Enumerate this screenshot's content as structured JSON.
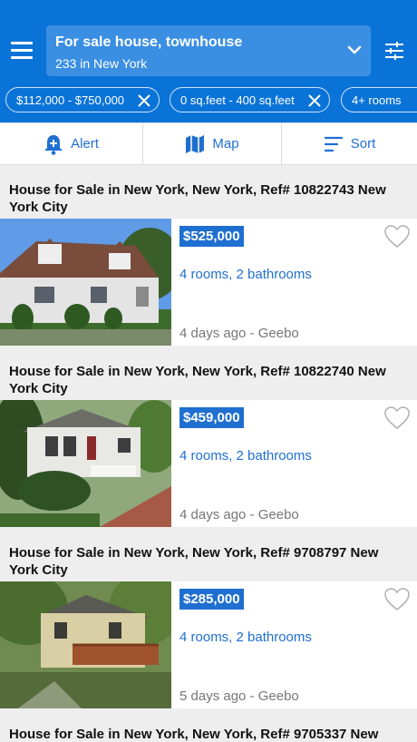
{
  "header": {
    "search_title": "For sale house, townhouse",
    "search_subtitle": "233 in New York",
    "background_color": "#0a73d8"
  },
  "filters": [
    {
      "label": "$112,000 - $750,000"
    },
    {
      "label": "0 sq.feet - 400 sq.feet"
    },
    {
      "label": "4+ rooms"
    }
  ],
  "toolbar": {
    "alert_label": "Alert",
    "map_label": "Map",
    "sort_label": "Sort"
  },
  "listings": [
    {
      "title": "House for Sale in New York, New York, Ref# 10822743 New York City",
      "price": "$525,000",
      "rooms": "4 rooms, 2 bathrooms",
      "age": "4 days ago - Geebo"
    },
    {
      "title": "House for Sale in New York, New York, Ref# 10822740 New York City",
      "price": "$459,000",
      "rooms": "4 rooms, 2 bathrooms",
      "age": "4 days ago - Geebo"
    },
    {
      "title": "House for Sale in New York, New York, Ref# 9708797 New York City",
      "price": "$285,000",
      "rooms": "4 rooms, 2 bathrooms",
      "age": "5 days ago - Geebo"
    },
    {
      "title": "House for Sale in New York, New York, Ref# 9705337 New"
    }
  ],
  "colors": {
    "accent": "#1f6fd1",
    "chip_border": "#cfe3f8"
  }
}
